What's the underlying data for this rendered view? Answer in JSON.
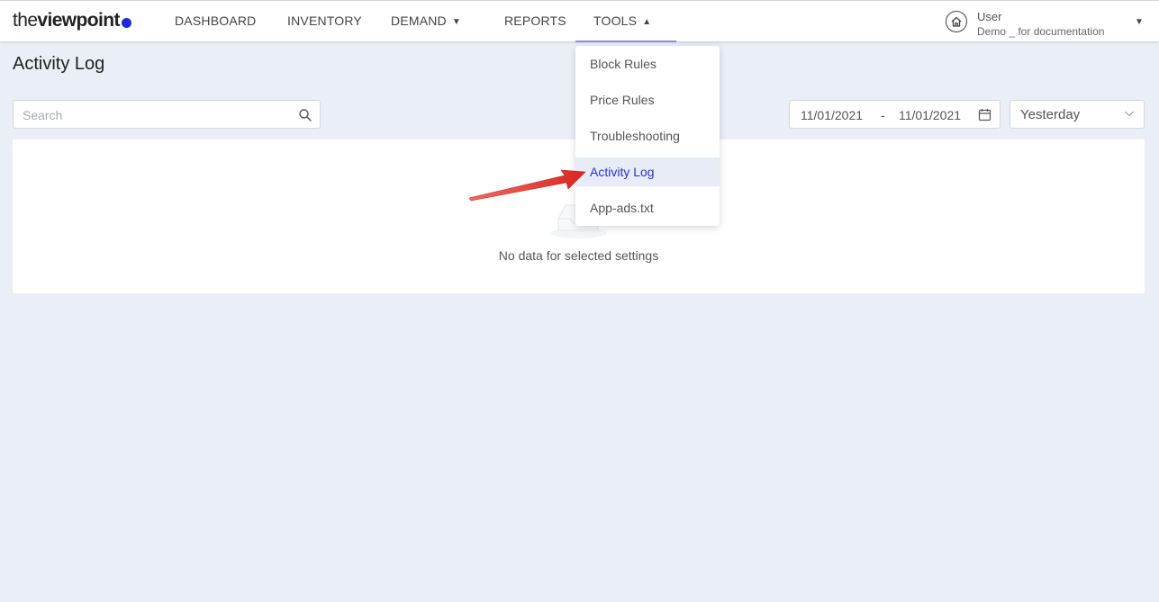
{
  "brand": {
    "prefix": "the",
    "suffix": "viewpoint",
    "dot_color": "#1f2bd9"
  },
  "nav": {
    "dashboard": "DASHBOARD",
    "inventory": "INVENTORY",
    "demand": "DEMAND",
    "reports": "REPORTS",
    "tools": "TOOLS"
  },
  "user": {
    "name": "User",
    "subtitle": "Demo _ for documentation"
  },
  "page": {
    "title": "Activity Log"
  },
  "search": {
    "placeholder": "Search",
    "value": ""
  },
  "date_range": {
    "start": "11/01/2021",
    "separator": "-",
    "end": "11/01/2021"
  },
  "period": {
    "selected": "Yesterday"
  },
  "empty_state": {
    "message": "No data for selected settings"
  },
  "tools_menu": {
    "items": [
      {
        "label": "Block Rules"
      },
      {
        "label": "Price Rules"
      },
      {
        "label": "Troubleshooting"
      },
      {
        "label": "Activity Log",
        "selected": true
      },
      {
        "label": "App-ads.txt"
      }
    ]
  },
  "colors": {
    "accent": "#2b33c7",
    "selected_bg": "#e8ecf6",
    "page_bg": "#eaeef6",
    "arrow": "#e03a32"
  }
}
